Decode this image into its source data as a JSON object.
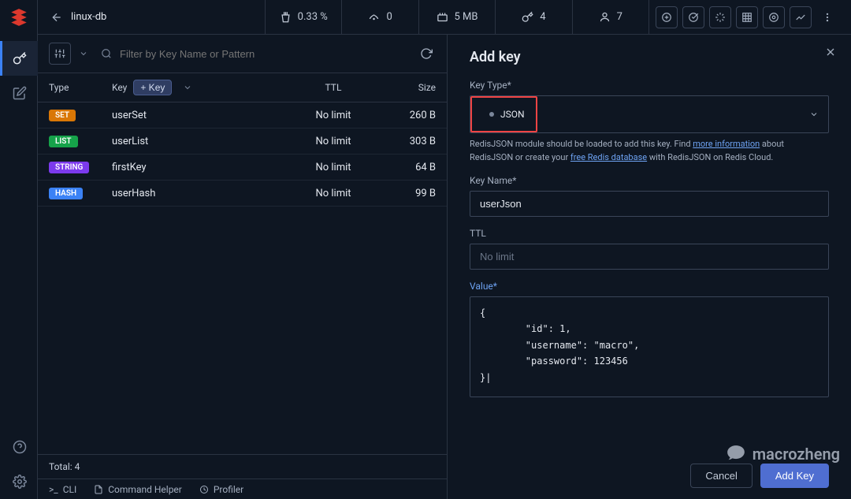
{
  "breadcrumb": {
    "db": "linux-db"
  },
  "stats": {
    "cpu": "0.33 %",
    "ops": "0",
    "mem": "5 MB",
    "keys": "4",
    "clients": "7"
  },
  "tools": {
    "i1": "workbench-icon",
    "i2": "bulk-icon",
    "i3": "pubsub-icon",
    "i4": "analysis-icon",
    "i5": "settings-icon",
    "i6": "chart-icon",
    "more": "more-icon"
  },
  "search": {
    "placeholder": "Filter by Key Name or Pattern"
  },
  "table": {
    "headers": {
      "type": "Type",
      "key": "Key",
      "add_key": "+ Key",
      "ttl": "TTL",
      "size": "Size"
    },
    "rows": [
      {
        "type_label": "SET",
        "type_class": "set",
        "key": "userSet",
        "ttl": "No limit",
        "size": "260 B"
      },
      {
        "type_label": "LIST",
        "type_class": "list",
        "key": "userList",
        "ttl": "No limit",
        "size": "303 B"
      },
      {
        "type_label": "STRING",
        "type_class": "string",
        "key": "firstKey",
        "ttl": "No limit",
        "size": "64 B"
      },
      {
        "type_label": "HASH",
        "type_class": "hash",
        "key": "userHash",
        "ttl": "No limit",
        "size": "99 B"
      }
    ],
    "total_text": "Total: 4"
  },
  "bottombar": {
    "cli": "CLI",
    "helper": "Command Helper",
    "profiler": "Profiler"
  },
  "pane": {
    "title": "Add key",
    "key_type_label": "Key Type*",
    "key_type_value": "JSON",
    "hint_1": "RedisJSON module should be loaded to add this key. Find ",
    "hint_link_1": "more information",
    "hint_2": " about RedisJSON or create your ",
    "hint_link_2": "free Redis database",
    "hint_3": " with RedisJSON on Redis Cloud.",
    "key_name_label": "Key Name*",
    "key_name_value": "userJson",
    "ttl_label": "TTL",
    "ttl_placeholder": "No limit",
    "value_label": "Value*",
    "value_text": "{\n        \"id\": 1,\n        \"username\": \"macro\",\n        \"password\": 123456\n}|",
    "cancel_label": "Cancel",
    "submit_label": "Add Key"
  },
  "watermark": "macrozheng"
}
